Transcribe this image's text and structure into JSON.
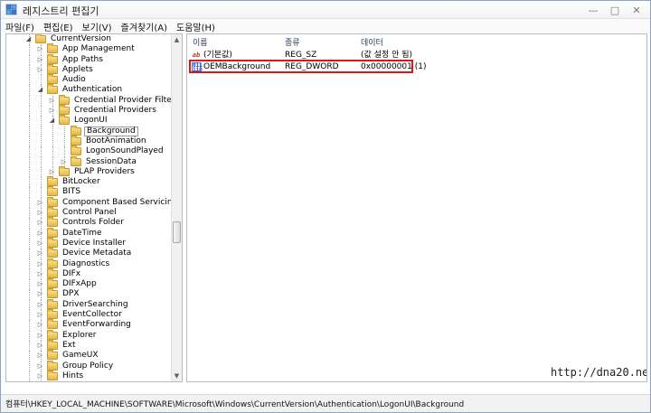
{
  "window": {
    "title": "레지스트리 편집기",
    "controls": {
      "minimize": "—",
      "maximize": "□",
      "close": "✕"
    }
  },
  "menu": [
    "파일(F)",
    "편집(E)",
    "보기(V)",
    "즐겨찾기(A)",
    "도움말(H)"
  ],
  "tree": {
    "items": [
      {
        "label": "CurrentVersion",
        "depth": 0,
        "state": "expanded"
      },
      {
        "label": "App Management",
        "depth": 1,
        "state": "collapsed"
      },
      {
        "label": "App Paths",
        "depth": 1,
        "state": "collapsed"
      },
      {
        "label": "Applets",
        "depth": 1,
        "state": "collapsed"
      },
      {
        "label": "Audio",
        "depth": 1,
        "state": "leaf"
      },
      {
        "label": "Authentication",
        "depth": 1,
        "state": "expanded"
      },
      {
        "label": "Credential Provider Filters",
        "depth": 2,
        "state": "collapsed"
      },
      {
        "label": "Credential Providers",
        "depth": 2,
        "state": "collapsed"
      },
      {
        "label": "LogonUI",
        "depth": 2,
        "state": "expanded"
      },
      {
        "label": "Background",
        "depth": 3,
        "state": "leaf",
        "selected": true
      },
      {
        "label": "BootAnimation",
        "depth": 3,
        "state": "leaf"
      },
      {
        "label": "LogonSoundPlayed",
        "depth": 3,
        "state": "leaf"
      },
      {
        "label": "SessionData",
        "depth": 3,
        "state": "collapsed"
      },
      {
        "label": "PLAP Providers",
        "depth": 2,
        "state": "collapsed"
      },
      {
        "label": "BitLocker",
        "depth": 1,
        "state": "leaf"
      },
      {
        "label": "BITS",
        "depth": 1,
        "state": "leaf"
      },
      {
        "label": "Component Based Servicing",
        "depth": 1,
        "state": "collapsed"
      },
      {
        "label": "Control Panel",
        "depth": 1,
        "state": "collapsed"
      },
      {
        "label": "Controls Folder",
        "depth": 1,
        "state": "collapsed"
      },
      {
        "label": "DateTime",
        "depth": 1,
        "state": "collapsed"
      },
      {
        "label": "Device Installer",
        "depth": 1,
        "state": "collapsed"
      },
      {
        "label": "Device Metadata",
        "depth": 1,
        "state": "collapsed"
      },
      {
        "label": "Diagnostics",
        "depth": 1,
        "state": "collapsed"
      },
      {
        "label": "DIFx",
        "depth": 1,
        "state": "collapsed"
      },
      {
        "label": "DIFxApp",
        "depth": 1,
        "state": "collapsed"
      },
      {
        "label": "DPX",
        "depth": 1,
        "state": "collapsed"
      },
      {
        "label": "DriverSearching",
        "depth": 1,
        "state": "collapsed"
      },
      {
        "label": "EventCollector",
        "depth": 1,
        "state": "collapsed"
      },
      {
        "label": "EventForwarding",
        "depth": 1,
        "state": "collapsed"
      },
      {
        "label": "Explorer",
        "depth": 1,
        "state": "collapsed"
      },
      {
        "label": "Ext",
        "depth": 1,
        "state": "collapsed"
      },
      {
        "label": "GameUX",
        "depth": 1,
        "state": "collapsed"
      },
      {
        "label": "Group Policy",
        "depth": 1,
        "state": "collapsed"
      },
      {
        "label": "Hints",
        "depth": 1,
        "state": "collapsed"
      }
    ],
    "scroll_position": 0.58
  },
  "values": {
    "columns": {
      "name": "이름",
      "type": "종류",
      "data": "데이터"
    },
    "rows": [
      {
        "icon": "string-value-icon",
        "icon_text": "ab",
        "name": "(기본값)",
        "type": "REG_SZ",
        "data": "(값 설정 안 됨)"
      },
      {
        "icon": "binary-value-icon",
        "icon_text": "011\n110",
        "name": "OEMBackground",
        "type": "REG_DWORD",
        "data": "0x00000001 (1)",
        "highlighted": true
      }
    ]
  },
  "watermark": "http://dna20.net",
  "status": "컴퓨터\\HKEY_LOCAL_MACHINE\\SOFTWARE\\Microsoft\\Windows\\CurrentVersion\\Authentication\\LogonUI\\Background",
  "colors": {
    "highlight": "#d11b1b",
    "folder": "#e4b747"
  }
}
